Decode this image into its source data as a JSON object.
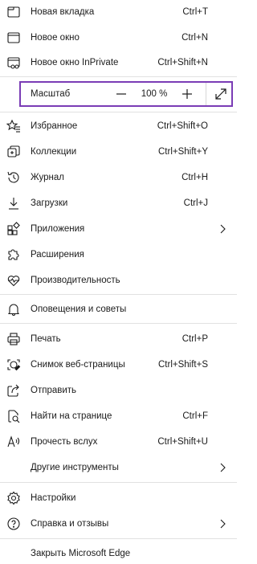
{
  "menu": {
    "new_tab": {
      "label": "Новая вкладка",
      "shortcut": "Ctrl+T"
    },
    "new_window": {
      "label": "Новое окно",
      "shortcut": "Ctrl+N"
    },
    "new_inprivate": {
      "label": "Новое окно InPrivate",
      "shortcut": "Ctrl+Shift+N"
    },
    "zoom": {
      "label": "Масштаб",
      "value": "100 %",
      "minus": "—",
      "plus": "+"
    },
    "favorites": {
      "label": "Избранное",
      "shortcut": "Ctrl+Shift+O"
    },
    "collections": {
      "label": "Коллекции",
      "shortcut": "Ctrl+Shift+Y"
    },
    "history": {
      "label": "Журнал",
      "shortcut": "Ctrl+H"
    },
    "downloads": {
      "label": "Загрузки",
      "shortcut": "Ctrl+J"
    },
    "apps": {
      "label": "Приложения"
    },
    "extensions": {
      "label": "Расширения"
    },
    "performance": {
      "label": "Производительность"
    },
    "alerts": {
      "label": "Оповещения и советы"
    },
    "print": {
      "label": "Печать",
      "shortcut": "Ctrl+P"
    },
    "web_capture": {
      "label": "Снимок веб-страницы",
      "shortcut": "Ctrl+Shift+S"
    },
    "share": {
      "label": "Отправить"
    },
    "find": {
      "label": "Найти на странице",
      "shortcut": "Ctrl+F"
    },
    "read_aloud": {
      "label": "Прочесть вслух",
      "shortcut": "Ctrl+Shift+U"
    },
    "more_tools": {
      "label": "Другие инструменты"
    },
    "settings": {
      "label": "Настройки"
    },
    "help": {
      "label": "Справка и отзывы"
    },
    "close": {
      "label": "Закрыть Microsoft Edge"
    }
  },
  "colors": {
    "zoom_highlight": "#7a3cb5",
    "divider": "#e1e1e1",
    "text": "#1b1b1b"
  }
}
